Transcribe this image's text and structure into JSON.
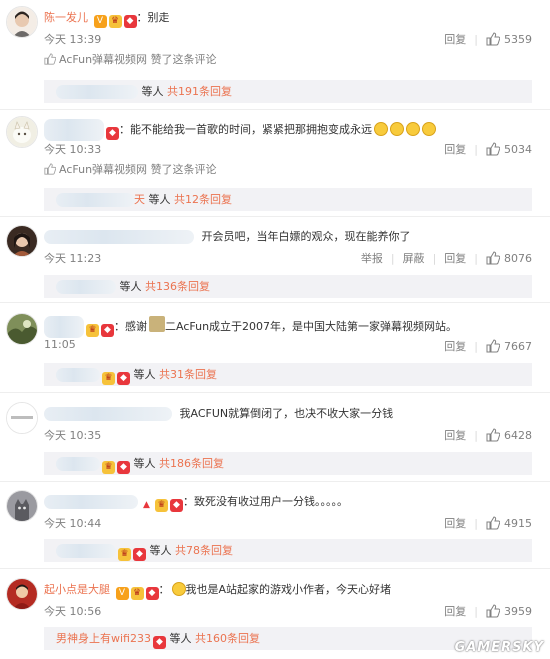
{
  "labels": {
    "reply": "回复",
    "report": "举报",
    "block": "屏蔽",
    "praised_by_suffix": "赞了这条评论",
    "total_prefix": "共",
    "replies_suffix": "条回复",
    "people_suffix": "等人"
  },
  "comments": [
    {
      "user": "陈一发儿",
      "text": "：别走",
      "time": "今天 13:39",
      "likes": "5359",
      "praised_by": "AcFun弹幕视频网",
      "sub_total": "191"
    },
    {
      "user": "",
      "text": "：能不能给我一首歌的时间，紧紧把那拥抱变成永远",
      "time": "今天 10:33",
      "likes": "5034",
      "praised_by": "AcFun弹幕视频网",
      "sub_total": "12",
      "sub_name_tail": "天"
    },
    {
      "user": "",
      "text": "开会员吧，当年白嫖的观众，现在能养你了",
      "time": "今天 11:23",
      "likes": "8076",
      "sub_total": "136"
    },
    {
      "user": "",
      "text": "：感谢",
      "text2": "二AcFun成立于2007年，是中国大陆第一家弹幕视频网站。",
      "time": "11:05",
      "likes": "7667",
      "sub_total": "31"
    },
    {
      "user": "",
      "text": "我ACFUN就算倒闭了，也决不收大家一分钱",
      "time": "今天 10:35",
      "likes": "6428",
      "sub_total": "186"
    },
    {
      "user": "",
      "text": "：致死没有收过用户一分钱。。。。。",
      "time": "今天 10:44",
      "likes": "4915",
      "sub_total": "78"
    },
    {
      "user": "起小点是大腿",
      "text": "我也是A站起家的游戏小作者，今天心好堵",
      "time": "今天 10:56",
      "likes": "3959",
      "sub_user": "男神身上有wifi233",
      "sub_total": "160"
    }
  ],
  "watermark": "GAMERSKY",
  "colors": {
    "username": "#eb7350",
    "meta": "#808080",
    "sub_bg": "#f2f2f5"
  }
}
